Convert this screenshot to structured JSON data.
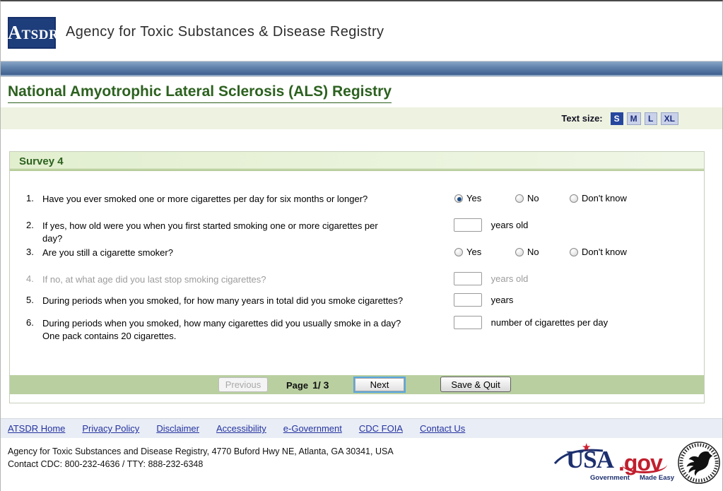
{
  "header": {
    "logo_a": "A",
    "logo_rest": "TSDR",
    "agency_name": "Agency for Toxic Substances & Disease Registry"
  },
  "page_title": "National Amyotrophic Lateral Sclerosis (ALS) Registry",
  "text_size": {
    "label": "Text size:",
    "options": [
      "S",
      "M",
      "L",
      "XL"
    ],
    "selected": "S"
  },
  "survey": {
    "title": "Survey 4",
    "questions": [
      {
        "number": "1.",
        "line1": "Have you ever smoked one or more cigarettes per day for six months or longer?",
        "type": "radio",
        "options": [
          "Yes",
          "No",
          "Don't know"
        ],
        "selected": "Yes",
        "disabled": false
      },
      {
        "number": "2.",
        "line1": "If yes, how old were you when you first started smoking one or more cigarettes per",
        "line2": "day?",
        "type": "input",
        "value": "",
        "suffix": "years old",
        "disabled": false
      },
      {
        "number": "3.",
        "line1": "Are you still a cigarette smoker?",
        "type": "radio",
        "options": [
          "Yes",
          "No",
          "Don't know"
        ],
        "selected": "",
        "disabled": false
      },
      {
        "number": "4.",
        "line1": "If no, at what age did you last stop smoking cigarettes?",
        "type": "input",
        "value": "",
        "suffix": "years old",
        "disabled": true
      },
      {
        "number": "5.",
        "line1": "During periods when you smoked, for how many years in total did you smoke cigarettes?",
        "type": "input",
        "value": "",
        "suffix": "years",
        "disabled": false
      },
      {
        "number": "6.",
        "line1": "During periods when you smoked, how many cigarettes did you usually smoke in a day?",
        "line2": "One pack contains 20 cigarettes.",
        "type": "input",
        "value": "",
        "suffix": "number of cigarettes per day",
        "disabled": false
      }
    ],
    "nav": {
      "previous": "Previous",
      "page_word": "Page",
      "page_value": "1/ 3",
      "next": "Next",
      "save_quit": "Save & Quit"
    }
  },
  "footer_links": {
    "items": [
      "ATSDR Home",
      "Privacy Policy",
      "Disclaimer",
      "Accessibility",
      "e-Government",
      "CDC FOIA",
      "Contact Us"
    ]
  },
  "footer": {
    "address": "Agency for Toxic Substances and Disease Registry, 4770 Buford Hwy NE, Atlanta, GA 30341, USA",
    "contact": "Contact CDC: 800-232-4636 / TTY: 888-232-6348",
    "usagov": {
      "usa": "USA",
      "gov": ".gov",
      "tagline1": "Government",
      "tagline2": "Made Easy"
    }
  },
  "colors": {
    "accent_green": "#2c611f",
    "nav_bar_green": "#b9cfa0",
    "header_blue": "#3f608f",
    "selected_size_bg": "#26479e",
    "link_blue": "#2433a0",
    "usa_navy": "#1c2f6e",
    "gov_red": "#c11f2e",
    "radio_dot": "#1e4e85"
  }
}
